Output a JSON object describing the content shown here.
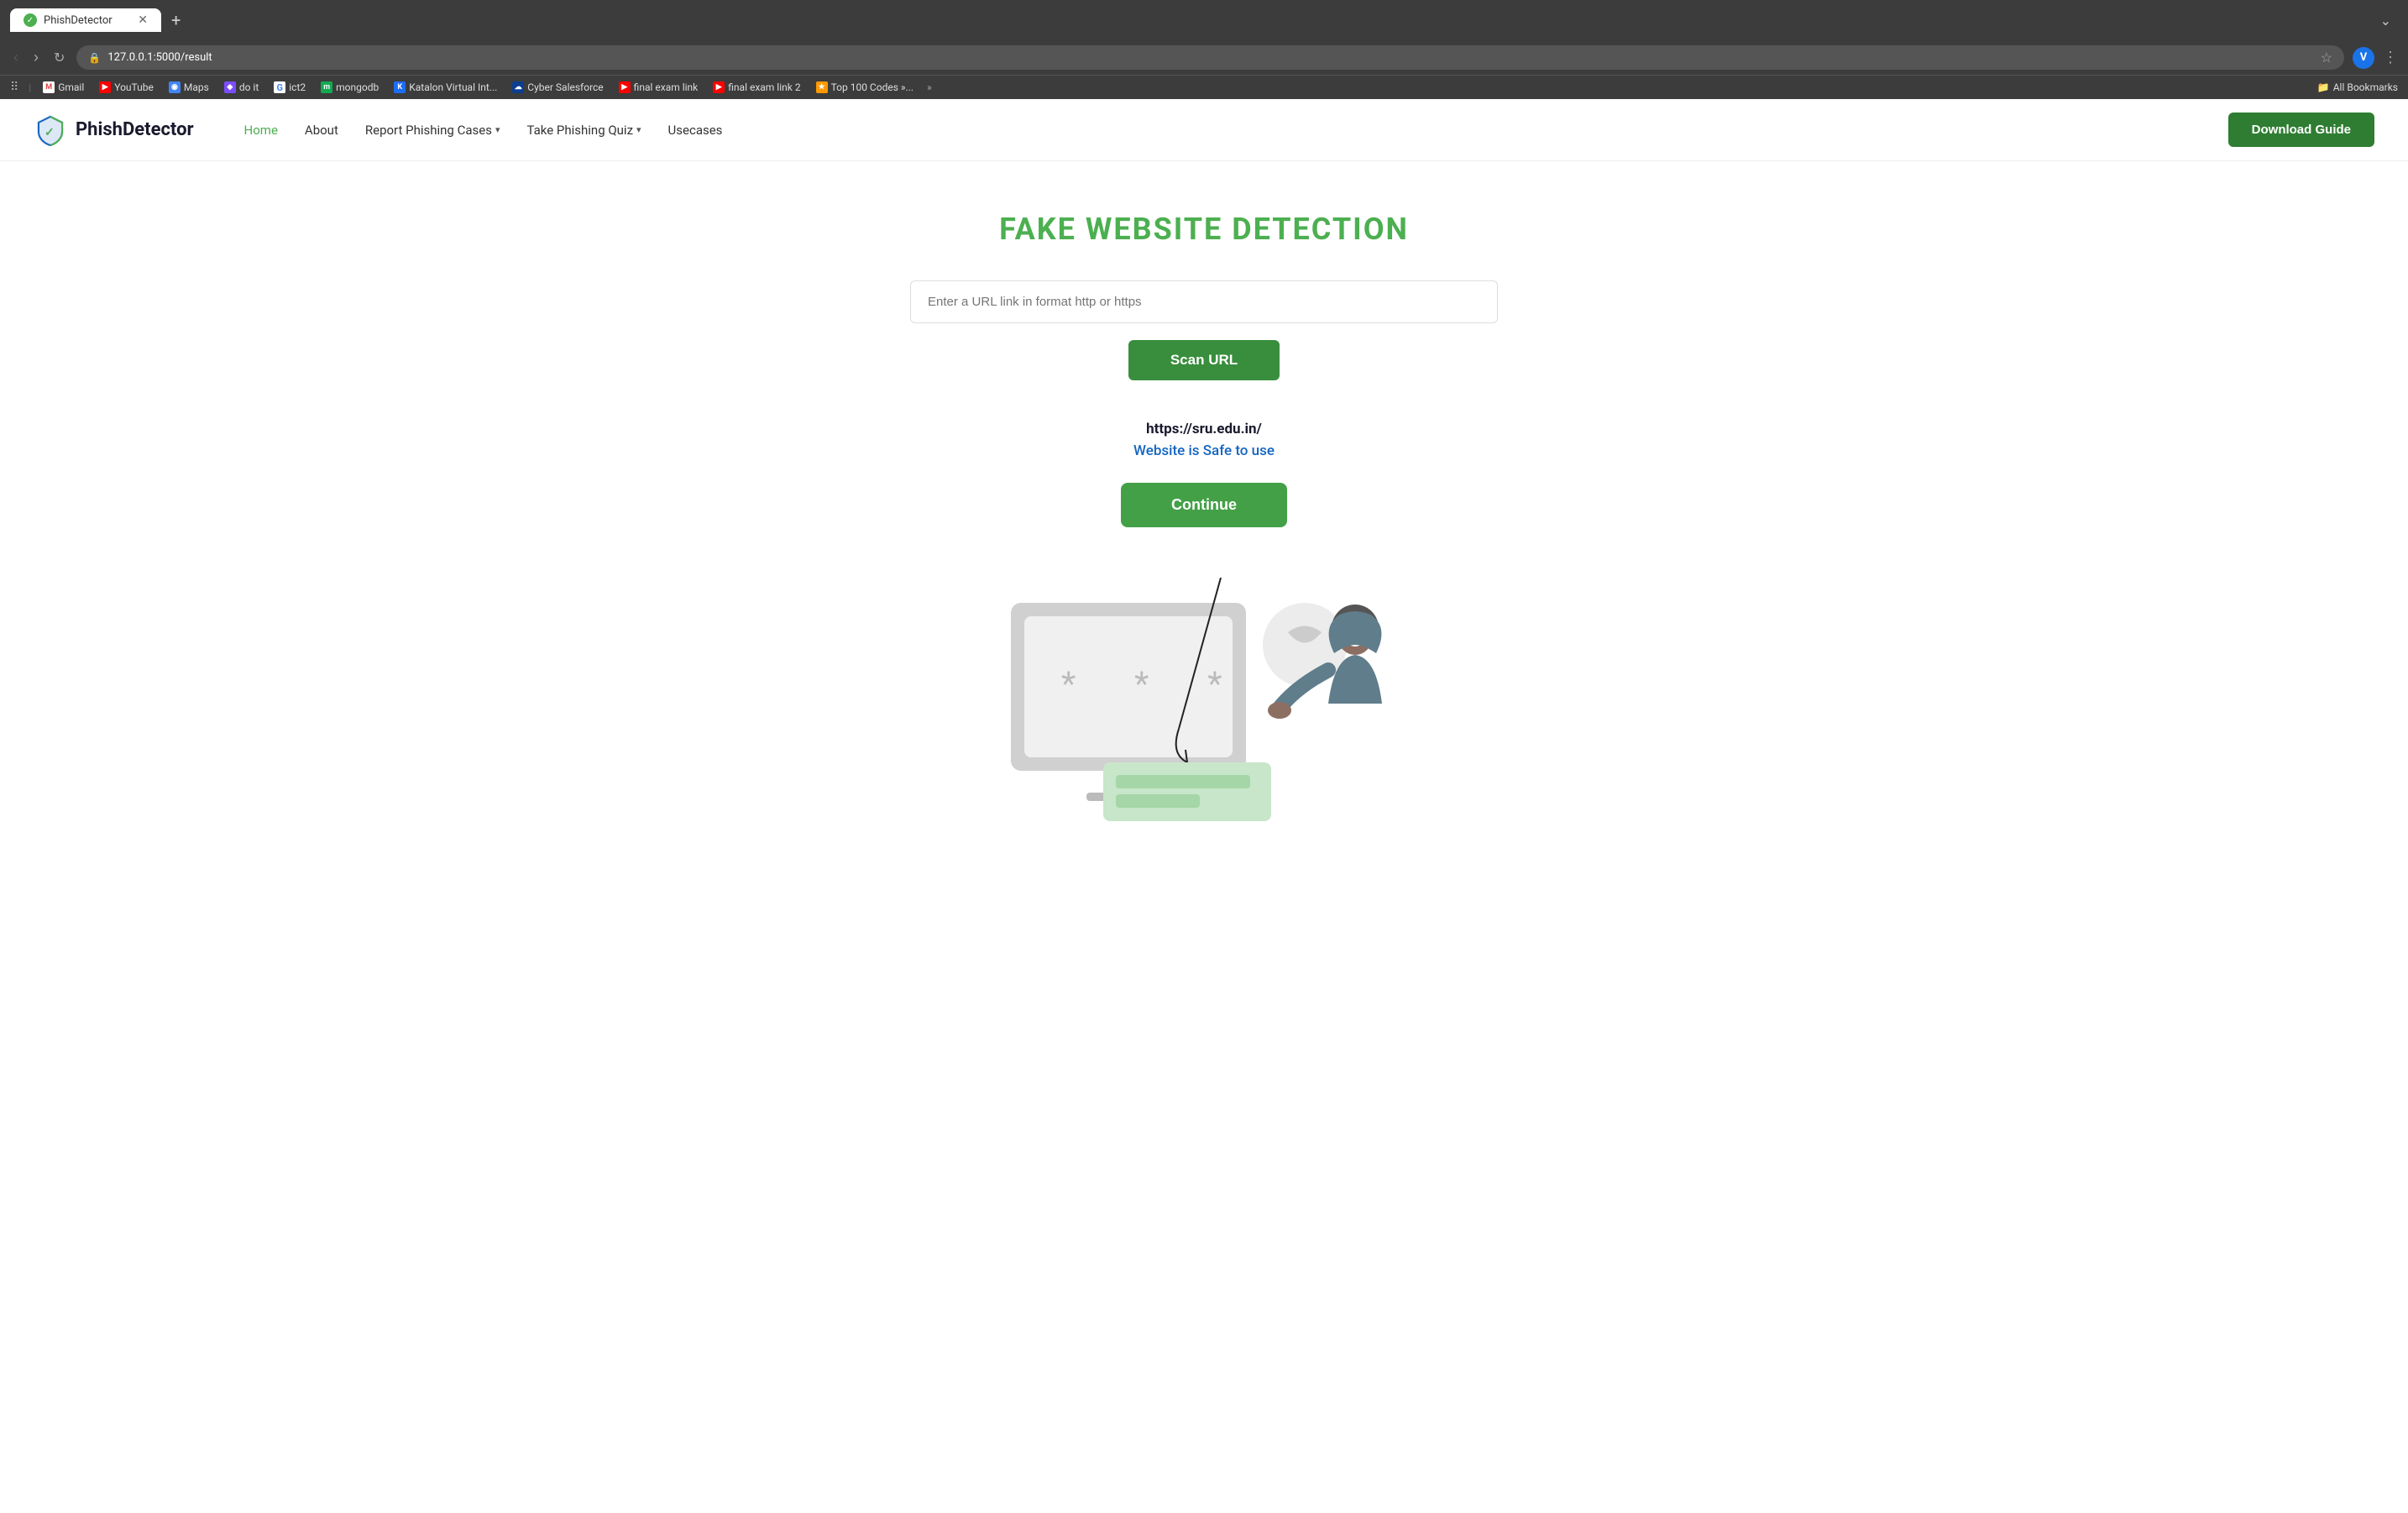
{
  "browser": {
    "tab": {
      "title": "PhishDetector",
      "favicon": "✓"
    },
    "url": "127.0.0.1:5000/result",
    "tab_new_label": "+",
    "expand_icon": "⌄",
    "profile_letter": "V"
  },
  "bookmarks": {
    "items": [
      {
        "id": "gmail",
        "label": "Gmail",
        "icon_class": "bm-gmail",
        "icon_text": "M"
      },
      {
        "id": "youtube",
        "label": "YouTube",
        "icon_class": "bm-youtube",
        "icon_text": "▶"
      },
      {
        "id": "maps",
        "label": "Maps",
        "icon_class": "bm-maps",
        "icon_text": "📍"
      },
      {
        "id": "doit",
        "label": "do it",
        "icon_class": "bm-doit",
        "icon_text": "◆"
      },
      {
        "id": "ict2",
        "label": "ict2",
        "icon_class": "bm-google",
        "icon_text": "G"
      },
      {
        "id": "mongodb",
        "label": "mongodb",
        "icon_class": "bm-mongodb",
        "icon_text": "🍃"
      },
      {
        "id": "katalon",
        "label": "Katalon Virtual Int...",
        "icon_class": "bm-katalon",
        "icon_text": "K"
      },
      {
        "id": "cyber",
        "label": "Cyber Salesforce",
        "icon_class": "bm-cyber",
        "icon_text": "☁"
      },
      {
        "id": "finalexam1",
        "label": "final exam link",
        "icon_class": "bm-ytred",
        "icon_text": "▶"
      },
      {
        "id": "finalexam2",
        "label": "final exam link 2",
        "icon_class": "bm-ytred",
        "icon_text": "▶"
      },
      {
        "id": "top100",
        "label": "Top 100 Codes »...",
        "icon_class": "bm-top100",
        "icon_text": "★"
      }
    ],
    "more_label": "»",
    "all_bookmarks_label": "All Bookmarks"
  },
  "navbar": {
    "logo_text": "PhishDetector",
    "links": [
      {
        "id": "home",
        "label": "Home",
        "active": true
      },
      {
        "id": "about",
        "label": "About",
        "active": false
      },
      {
        "id": "report",
        "label": "Report Phishing Cases",
        "dropdown": true,
        "active": false
      },
      {
        "id": "quiz",
        "label": "Take Phishing Quiz",
        "dropdown": true,
        "active": false
      },
      {
        "id": "usecases",
        "label": "Usecases",
        "active": false
      }
    ],
    "cta_button": "Download Guide"
  },
  "main": {
    "title": "FAKE WEBSITE DETECTION",
    "url_input_placeholder": "Enter a URL link in format http or https",
    "scan_button": "Scan URL",
    "result_url": "https://sru.edu.in/",
    "result_status": "Website is Safe to use",
    "continue_button": "Continue"
  }
}
